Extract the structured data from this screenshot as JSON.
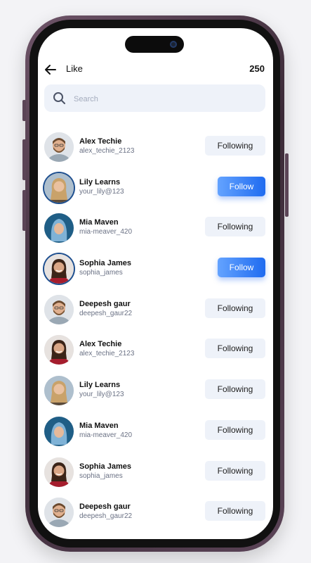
{
  "header": {
    "title": "Like",
    "count": "250"
  },
  "search": {
    "placeholder": "Search"
  },
  "users": [
    {
      "name": "Alex Techie",
      "handle": "alex_techie_2123",
      "action": "Following",
      "avatar": "man-beard"
    },
    {
      "name": "Lily Learns",
      "handle": "your_lily@123",
      "action": "Follow",
      "avatar": "woman-blonde"
    },
    {
      "name": "Mia Maven",
      "handle": "mia-meaver_420",
      "action": "Following",
      "avatar": "woman-hood"
    },
    {
      "name": "Sophia James",
      "handle": "sophia_james",
      "action": "Follow",
      "avatar": "woman-dark"
    },
    {
      "name": "Deepesh gaur",
      "handle": "deepesh_gaur22",
      "action": "Following",
      "avatar": "man-beard"
    },
    {
      "name": "Alex Techie",
      "handle": "alex_techie_2123",
      "action": "Following",
      "avatar": "woman-dark"
    },
    {
      "name": "Lily Learns",
      "handle": "your_lily@123",
      "action": "Following",
      "avatar": "woman-blonde"
    },
    {
      "name": "Mia Maven",
      "handle": "mia-meaver_420",
      "action": "Following",
      "avatar": "woman-hood"
    },
    {
      "name": "Sophia James",
      "handle": "sophia_james",
      "action": "Following",
      "avatar": "woman-dark"
    },
    {
      "name": "Deepesh gaur",
      "handle": "deepesh_gaur22",
      "action": "Following",
      "avatar": "man-beard"
    }
  ],
  "colors": {
    "accent": "#2f7cf6",
    "frame": "#5a4356",
    "button_bg": "#eef2f9"
  },
  "icons": {
    "back": "arrow-left-icon",
    "search": "search-icon"
  }
}
